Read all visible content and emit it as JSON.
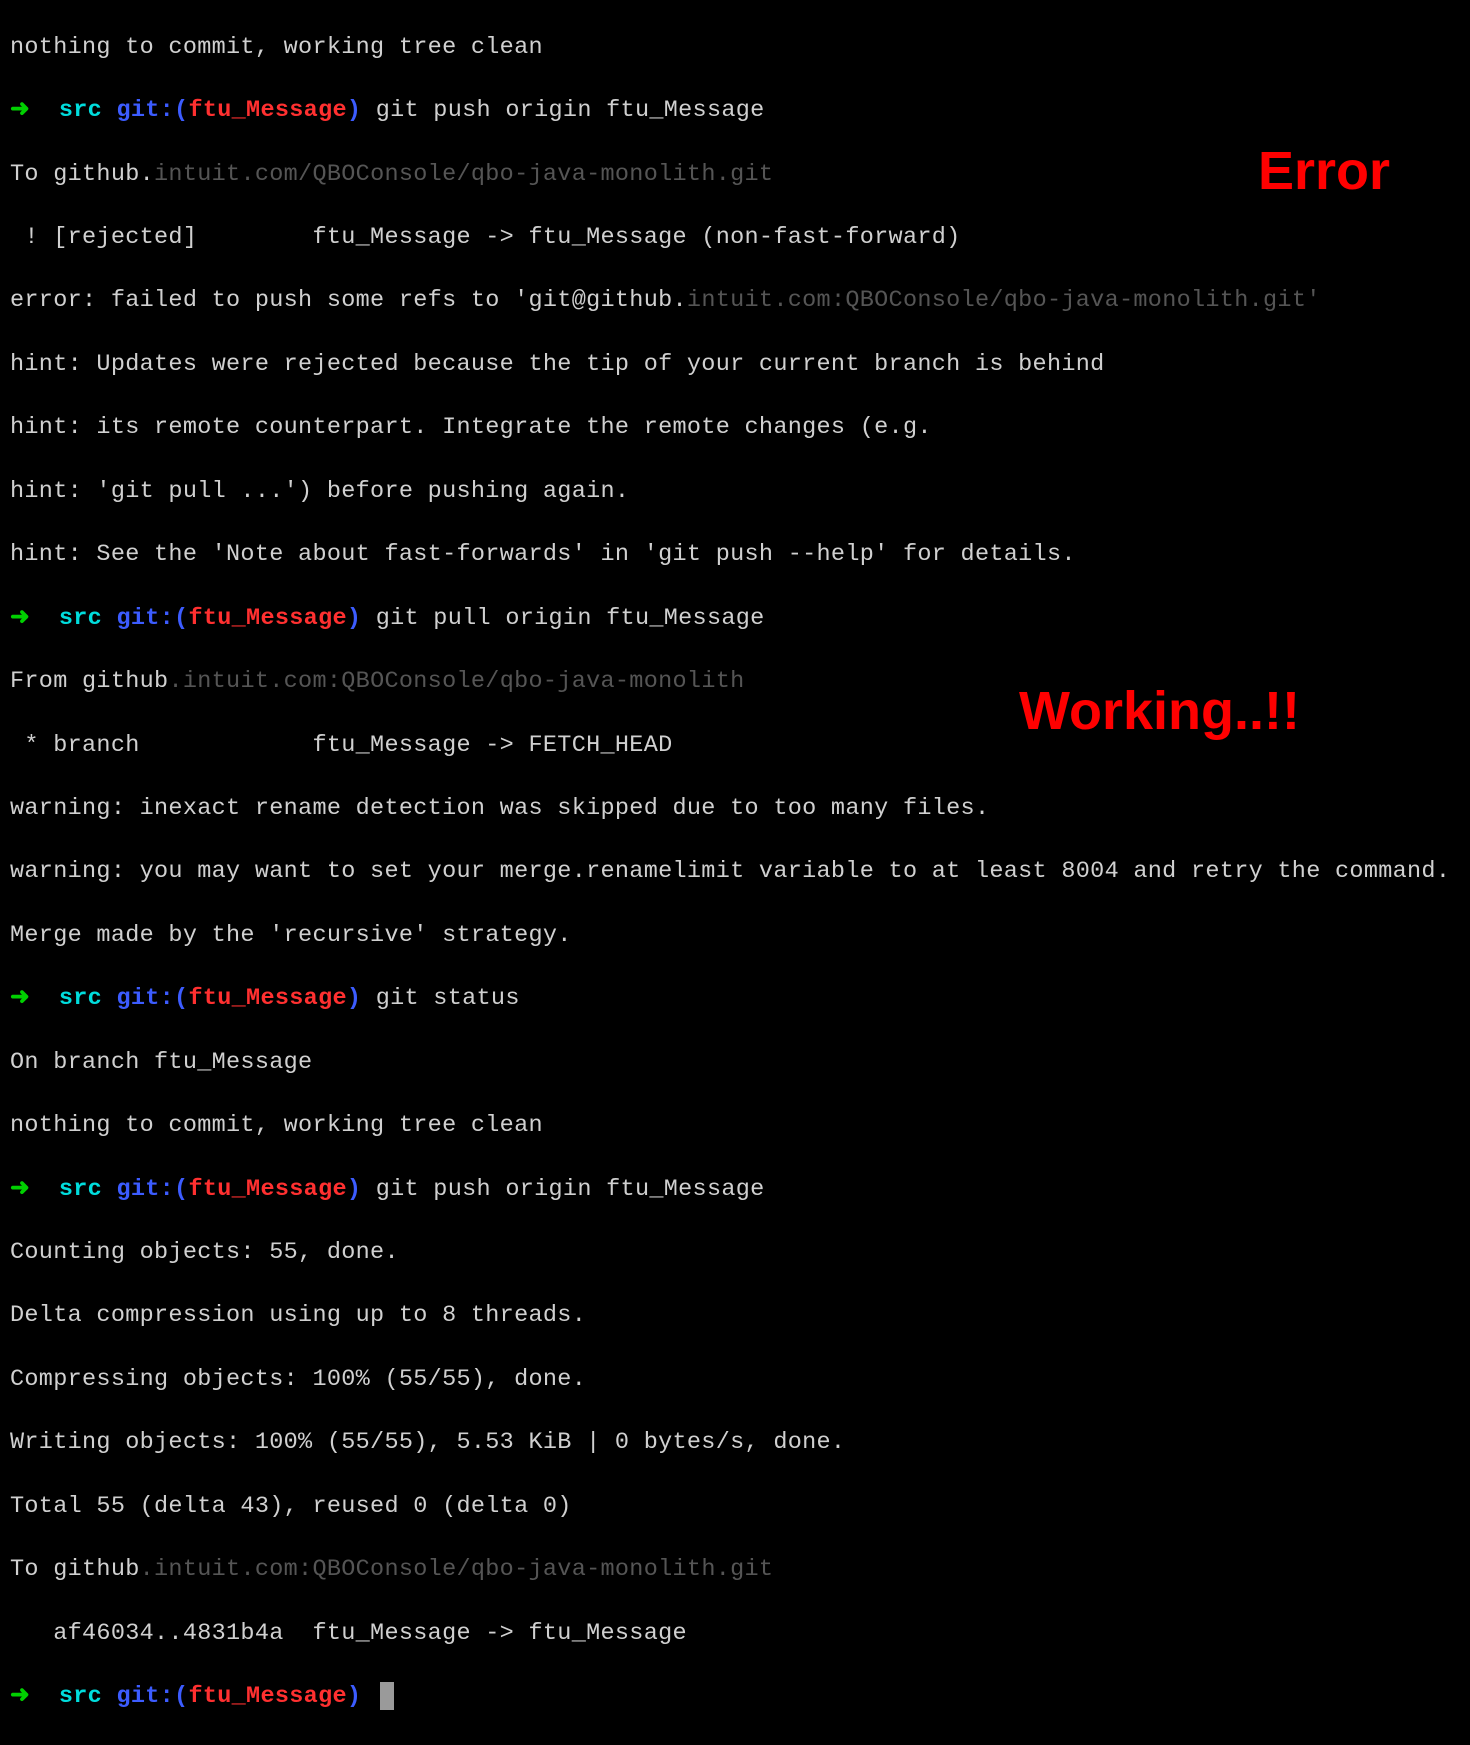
{
  "prompt": {
    "arrow": "➜",
    "dir": "src",
    "gitprefix": "git:(",
    "branch": "ftu_Message",
    "gitsuffix": ")"
  },
  "commands": {
    "push1": "git push origin ftu_Message",
    "pull": "git pull origin ftu_Message",
    "status": "git status",
    "push2": "git push origin ftu_Message"
  },
  "output": {
    "line0": "nothing to commit, working tree clean",
    "push1_to": "To github.",
    "push1_to_dim": "intuit.com/QBOConsole/qbo-java-monolith.git",
    "push1_rejected": " ! [rejected]        ftu_Message -> ftu_Message (non-fast-forward)",
    "push1_error": "error: failed to push some refs to 'git@github.",
    "push1_error_dim": "intuit.com:QBOConsole/qbo-java-monolith.git'",
    "push1_hint1": "hint: Updates were rejected because the tip of your current branch is behind",
    "push1_hint2": "hint: its remote counterpart. Integrate the remote changes (e.g.",
    "push1_hint3": "hint: 'git pull ...') before pushing again.",
    "push1_hint4": "hint: See the 'Note about fast-forwards' in 'git push --help' for details.",
    "pull_from": "From github",
    "pull_from_dim": ".intuit.com:QBOConsole/qbo-java-monolith",
    "pull_branch": " * branch            ftu_Message -> FETCH_HEAD",
    "pull_warn1": "warning: inexact rename detection was skipped due to too many files.",
    "pull_warn2": "warning: you may want to set your merge.renamelimit variable to at least 8004 and retry the command.",
    "pull_merge": "Merge made by the 'recursive' strategy.",
    "status_branch": "On branch ftu_Message",
    "status_clean": "nothing to commit, working tree clean",
    "push2_counting": "Counting objects: 55, done.",
    "push2_delta": "Delta compression using up to 8 threads.",
    "push2_compress": "Compressing objects: 100% (55/55), done.",
    "push2_writing": "Writing objects: 100% (55/55), 5.53 KiB | 0 bytes/s, done.",
    "push2_total": "Total 55 (delta 43), reused 0 (delta 0)",
    "push2_to": "To github",
    "push2_to_dim": ".intuit.com:QBOConsole/qbo-java-monolith.git",
    "push2_refs": "   af46034..4831b4a  ftu_Message -> ftu_Message"
  },
  "annotations": {
    "error": "Error",
    "working": "Working..!!"
  }
}
